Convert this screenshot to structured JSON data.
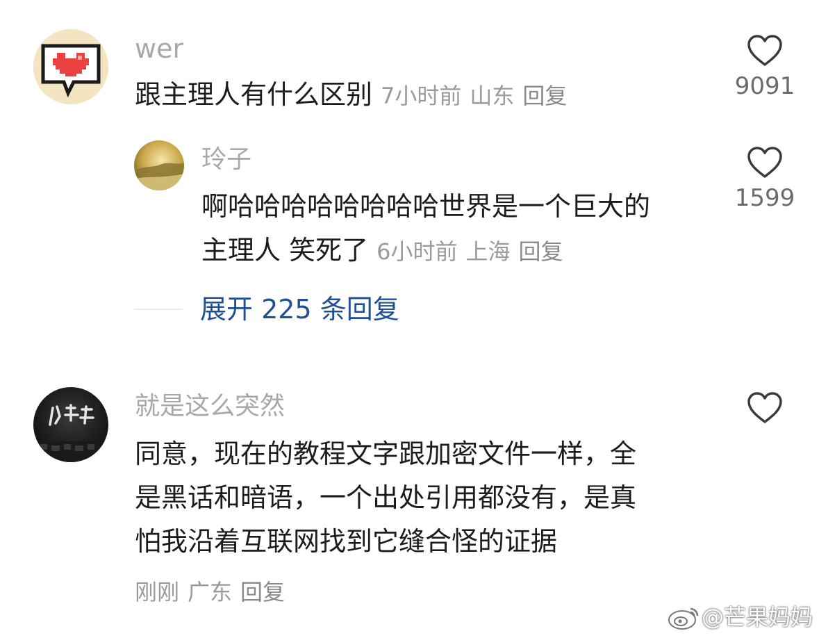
{
  "comments": [
    {
      "username": "wer",
      "text": "跟主理人有什么区别",
      "time": "7小时前",
      "location": "山东",
      "reply_label": "回复",
      "likes": "9091",
      "replies": [
        {
          "username": "玲子",
          "text_line1": "啊哈哈哈哈哈哈哈哈世界是一个巨大的",
          "text_line2": "主理人 笑死了",
          "time": "6小时前",
          "location": "上海",
          "reply_label": "回复",
          "likes": "1599"
        }
      ],
      "expand_label": "展开 225 条回复"
    },
    {
      "username": "就是这么突然",
      "text_line1": "同意，现在的教程文字跟加密文件一样，全",
      "text_line2": "是黑话和暗语，一个出处引用都没有，是真",
      "text_line3": "怕我沿着互联网找到它缝合怪的证据",
      "time": "刚刚",
      "location": "广东",
      "reply_label": "回复"
    }
  ],
  "watermark": "@芒果妈妈",
  "icons": {
    "like": "heart-outline-icon",
    "watermark_logo": "weibo-logo-icon"
  }
}
